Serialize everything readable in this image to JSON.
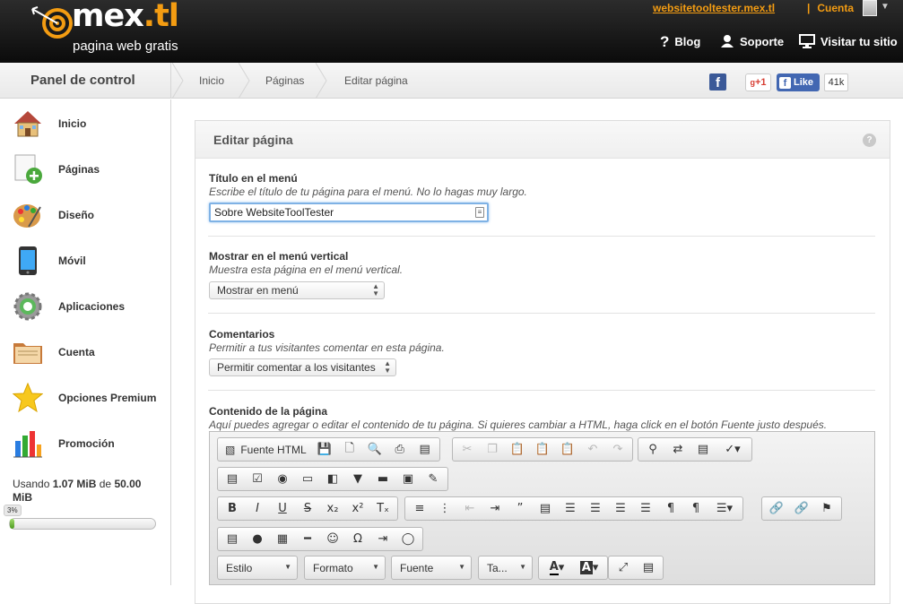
{
  "header": {
    "logo_name": "mex",
    "logo_tld": ".tl",
    "logo_tagline": "pagina web gratis",
    "site_link": "websitetooltester.mex.tl",
    "account_label": "Cuenta",
    "nav": [
      {
        "label": "Blog",
        "icon": "help-icon"
      },
      {
        "label": "Soporte",
        "icon": "user-icon"
      },
      {
        "label": "Visitar tu sitio",
        "icon": "monitor-icon"
      }
    ]
  },
  "breadcrumb_bar": {
    "panel_title": "Panel de control",
    "crumbs": [
      "Inicio",
      "Páginas",
      "Editar página"
    ],
    "gplus_label": "+1",
    "fb_like_label": "Like",
    "fb_like_count": "41k",
    "facebook_icon_glyph": "f"
  },
  "sidebar": {
    "items": [
      {
        "label": "Inicio",
        "icon": "house-icon"
      },
      {
        "label": "Páginas",
        "icon": "add-page-icon"
      },
      {
        "label": "Diseño",
        "icon": "palette-icon"
      },
      {
        "label": "Móvil",
        "icon": "mobile-phone-icon"
      },
      {
        "label": "Aplicaciones",
        "icon": "gear-icon"
      },
      {
        "label": "Cuenta",
        "icon": "folder-icon"
      },
      {
        "label": "Opciones Premium",
        "icon": "star-icon"
      },
      {
        "label": "Promoción",
        "icon": "bar-chart-icon"
      }
    ],
    "usage": {
      "prefix": "Usando",
      "used": "1.07 MiB",
      "connector": "de",
      "total": "50.00 MiB",
      "percent_label": "3%",
      "percent": 3
    }
  },
  "editor_panel": {
    "title": "Editar página",
    "fields": {
      "menu_title": {
        "label": "Título en el menú",
        "hint": "Escribe el título de tu página para el menú. No lo hagas muy largo.",
        "value": "Sobre WebsiteToolTester"
      },
      "vertical_menu": {
        "label": "Mostrar en el menú vertical",
        "hint": "Muestra esta página en el menú vertical.",
        "selected": "Mostrar en menú"
      },
      "comments": {
        "label": "Comentarios",
        "hint": "Permitir a tus visitantes comentar en esta página.",
        "selected": "Permitir comentar a los visitantes"
      },
      "content": {
        "label": "Contenido de la página",
        "hint": "Aquí puedes agregar o editar el contenido de tu página. Si quieres cambiar a HTML, haga click en el botón Fuente justo después."
      }
    },
    "toolbar": {
      "source_label": "Fuente HTML",
      "combos": [
        "Estilo",
        "Formato",
        "Fuente",
        "Ta..."
      ],
      "text_color_glyph": "A",
      "bg_color_glyph": "A"
    }
  }
}
